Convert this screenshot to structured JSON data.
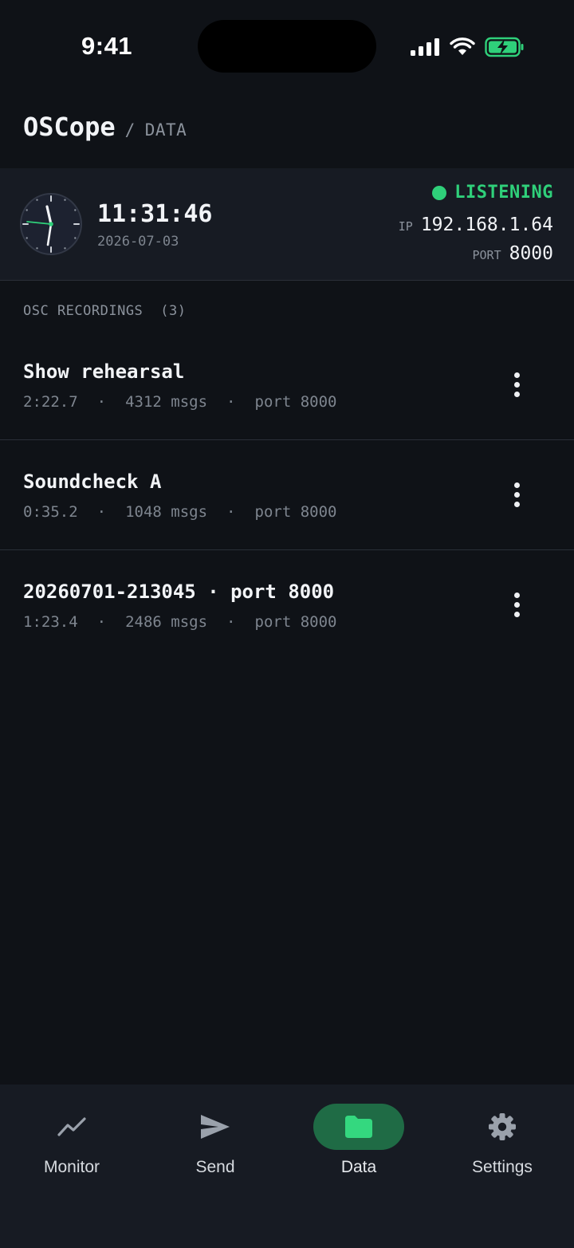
{
  "status_bar": {
    "time": "9:41"
  },
  "header": {
    "app_name": "OSCope",
    "separator": "/",
    "current": "DATA"
  },
  "status": {
    "time": "11:31:46",
    "date": "2026-07-03",
    "state": "LISTENING",
    "state_color": "#2fd07a",
    "ip_label": "IP",
    "ip": "192.168.1.64",
    "port_label": "PORT",
    "port": "8000"
  },
  "recordings": {
    "heading": "OSC RECORDINGS",
    "count": "(3)",
    "items": [
      {
        "title": "Show rehearsal",
        "duration": "2:22.7",
        "messages": "4312 msgs",
        "port": "port 8000"
      },
      {
        "title": "Soundcheck A",
        "duration": "0:35.2",
        "messages": "1048 msgs",
        "port": "port 8000"
      },
      {
        "title": "20260701-213045 · port 8000",
        "duration": "1:23.4",
        "messages": "2486 msgs",
        "port": "port 8000"
      }
    ],
    "meta_separator": "·"
  },
  "tabs": [
    {
      "label": "Monitor",
      "icon": "trend-icon"
    },
    {
      "label": "Send",
      "icon": "send-icon"
    },
    {
      "label": "Data",
      "icon": "folder-icon",
      "active": true
    },
    {
      "label": "Settings",
      "icon": "gear-icon"
    }
  ],
  "colors": {
    "background": "#0f1217",
    "card": "#171b23",
    "accent": "#2fd07a",
    "active_tab_bg": "#1f6b45"
  }
}
